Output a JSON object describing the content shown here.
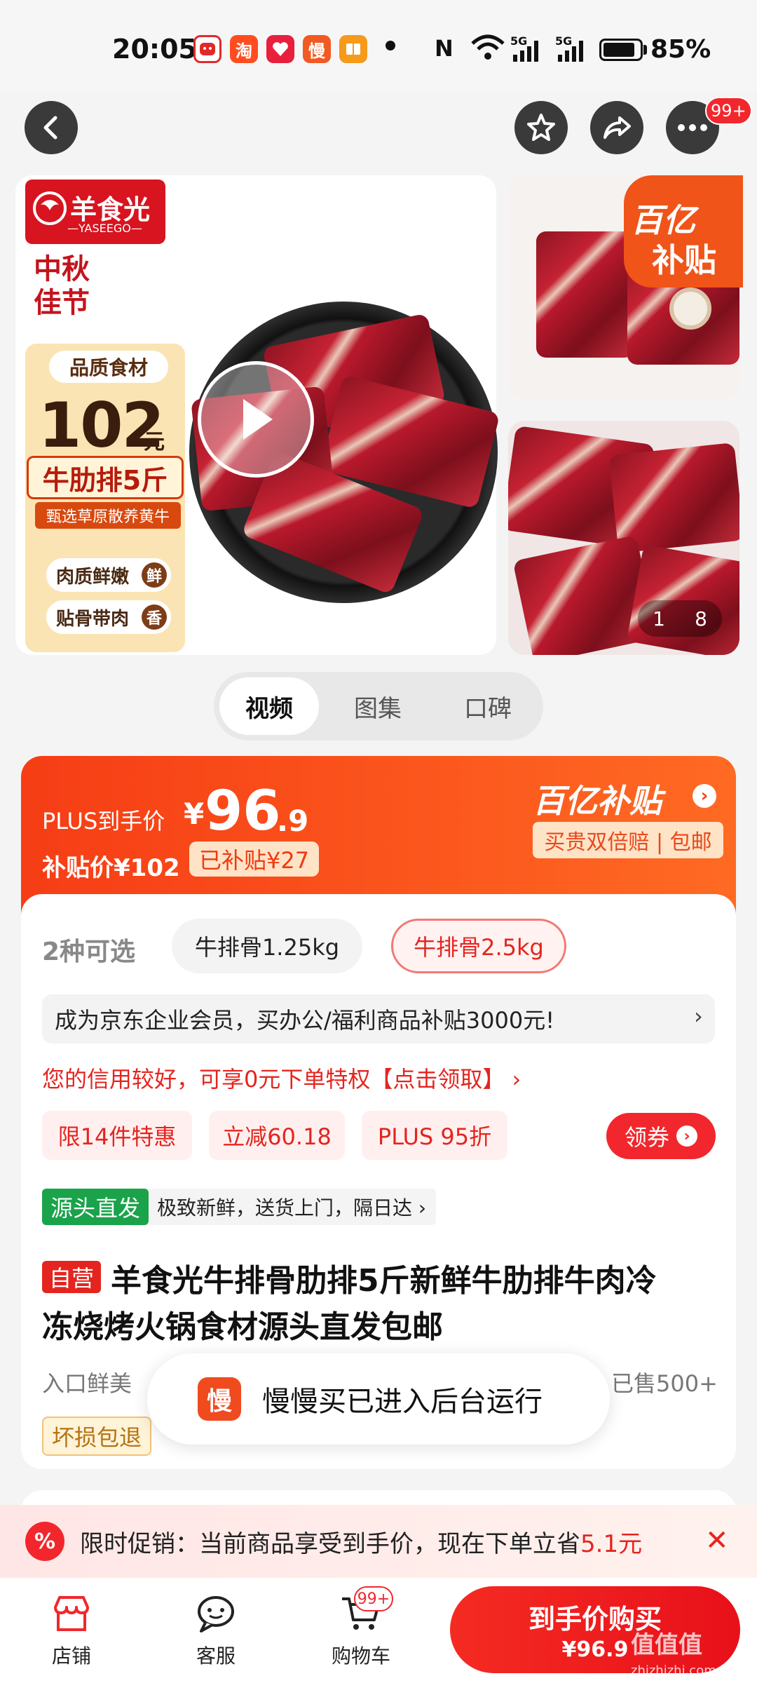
{
  "status_bar": {
    "time": "20:05",
    "nfc": "N",
    "battery": "85%",
    "net1": "5G",
    "net2": "5G",
    "app_icons": [
      "淘",
      "慢"
    ]
  },
  "nav": {
    "cart_badge": "99+"
  },
  "gallery": {
    "brand": "羊食光",
    "brand_en": "—YASEEGO—",
    "festival": [
      "中秋",
      "佳节"
    ],
    "poster_quality": "品质食材",
    "poster_price": "102",
    "poster_unit": "元",
    "poster_product": "牛肋排5斤",
    "poster_sub": "甄选草原散养黄牛",
    "poster_tags": [
      {
        "text": "肉质鲜嫩",
        "mark": "鲜"
      },
      {
        "text": "贴骨带肉",
        "mark": "香"
      }
    ],
    "subsidy_ribbon": [
      "百亿",
      "补贴"
    ],
    "counter_current": "1",
    "counter_total": "8"
  },
  "tabs": [
    {
      "label": "视频",
      "active": true
    },
    {
      "label": "图集"
    },
    {
      "label": "口碑"
    }
  ],
  "price": {
    "plus_label": "PLUS到手价",
    "currency": "¥",
    "int": "96",
    "dec": ".9",
    "sub_label": "补贴价¥102",
    "sub_badge": "已补贴¥27",
    "subsidy_brand": "百亿补贴",
    "subsidy_tag": "买贵双倍赔 | 包邮"
  },
  "options": {
    "count_label": "2种可选",
    "items": [
      "牛排骨1.25kg",
      "牛排骨2.5kg"
    ]
  },
  "enterprise": "成为京东企业会员，买办公/福利商品补贴3000元!",
  "credit": "您的信用较好，可享0元下单特权【点击领取】 ›",
  "promos": [
    "限14件特惠",
    "立减60.18",
    "PLUS 95折"
  ],
  "coupon": "领券",
  "source": {
    "tag": "源头直发",
    "text": "极致新鲜，送货上门，隔日达 ›"
  },
  "product": {
    "self_tag": "自营",
    "title_line1": "羊食光牛排骨肋排5斤新鲜牛肋排牛肉冷",
    "title_line2": "冻烧烤火锅食材源头直发包邮",
    "attrs": "入口鲜美",
    "sold": "已售500+",
    "guarantee": "坏损包退"
  },
  "toast": {
    "icon": "慢",
    "text": "慢慢买已进入后台运行"
  },
  "promo_bar": {
    "icon": "%",
    "text": "限时促销：当前商品享受到手价，现在下单立省",
    "amount": "5.1元"
  },
  "bottom": {
    "store": "店铺",
    "service": "客服",
    "cart": "购物车",
    "cart_badge": "99+",
    "buy_l1": "到手价购买",
    "buy_l2": "¥96.9"
  },
  "watermark": {
    "main": "值值值",
    "url": "zhizhizhi.com"
  },
  "colors": {
    "accent": "#f2272d",
    "orange": "#ff5a1f",
    "green": "#1aa34a"
  }
}
